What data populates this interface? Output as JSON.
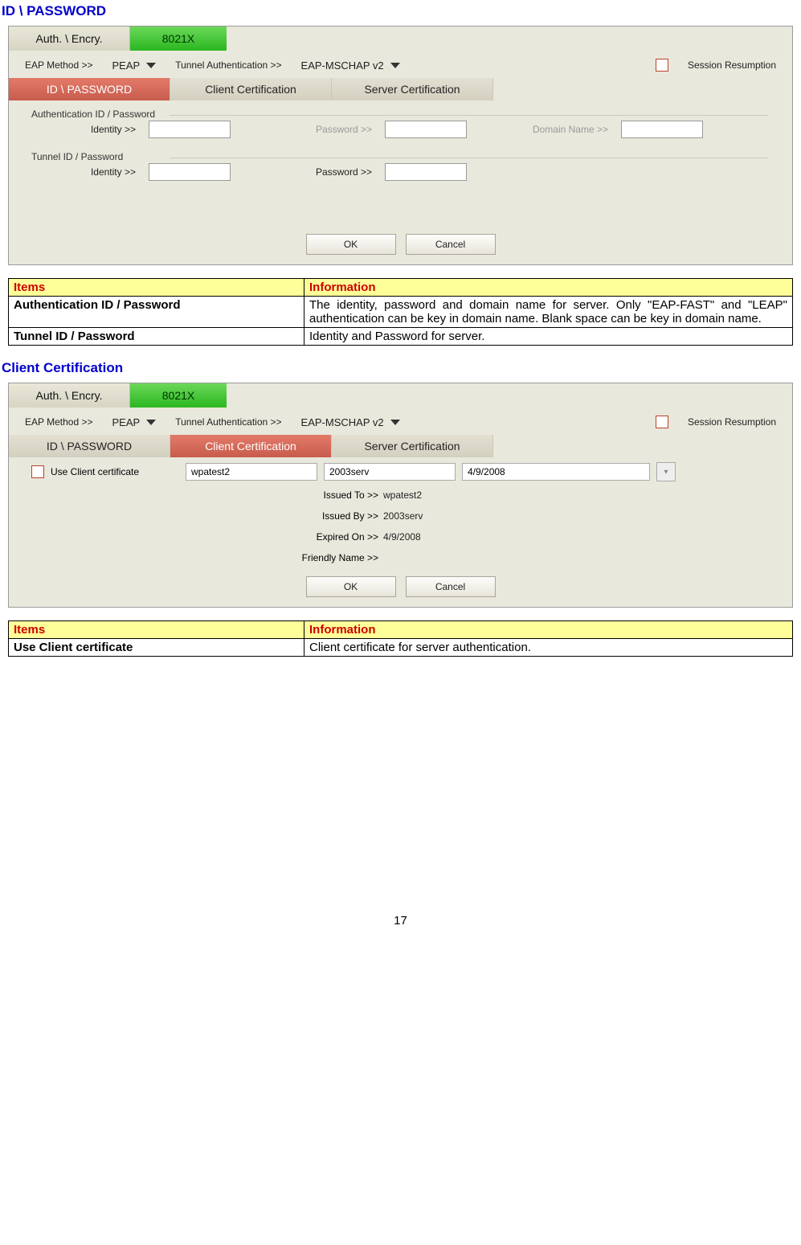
{
  "section1_title": "ID \\ PASSWORD",
  "section2_title": "Client Certification",
  "tabs": {
    "auth": "Auth. \\ Encry.",
    "x8021": "8021X"
  },
  "eap_row": {
    "eap_method_label": "EAP Method >>",
    "eap_method_value": "PEAP",
    "tunnel_auth_label": "Tunnel Authentication >>",
    "tunnel_auth_value": "EAP-MSCHAP v2",
    "session_label": "Session Resumption"
  },
  "sub_tabs": {
    "idpw": "ID \\ PASSWORD",
    "client": "Client Certification",
    "server": "Server Certification"
  },
  "panel1": {
    "group1": "Authentication ID / Password",
    "identity_label": "Identity >>",
    "password_label": "Password >>",
    "domain_label": "Domain Name >>",
    "group2": "Tunnel ID / Password",
    "ok": "OK",
    "cancel": "Cancel"
  },
  "table1": {
    "h1": "Items",
    "h2": "Information",
    "r1c1": "Authentication ID / Password",
    "r1c2": "The identity, password and domain name for server. Only \"EAP-FAST\" and \"LEAP\" authentication can be key in domain name. Blank space can be key in domain name.",
    "r2c1": "Tunnel ID / Password",
    "r2c2": "Identity and Password for server."
  },
  "panel2": {
    "use_client_label": "Use Client certificate",
    "cert_c1": "wpatest2",
    "cert_c2": "2003serv",
    "cert_c3": "4/9/2008",
    "issued_to_label": "Issued To >>",
    "issued_to_value": "wpatest2",
    "issued_by_label": "Issued By >>",
    "issued_by_value": "2003serv",
    "expired_label": "Expired On >>",
    "expired_value": "4/9/2008",
    "friendly_label": "Friendly Name >>",
    "friendly_value": "",
    "ok": "OK",
    "cancel": "Cancel"
  },
  "table2": {
    "h1": "Items",
    "h2": "Information",
    "r1c1": "Use Client certificate",
    "r1c2": "Client certificate for server authentication."
  },
  "page_number": "17"
}
